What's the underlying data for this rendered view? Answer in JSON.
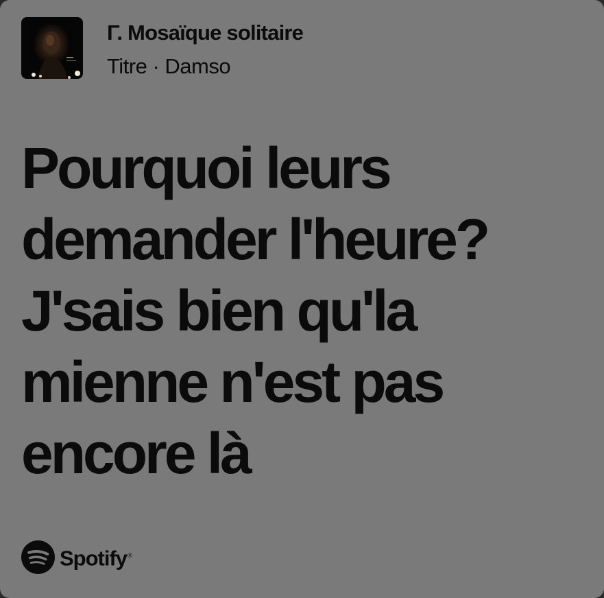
{
  "track": {
    "title": "Γ. Mosaïque solitaire",
    "subtitle": "Titre · Damso",
    "cover_icon": "album-cover-image"
  },
  "lyrics": {
    "lines": [
      "Pourquoi leurs",
      "demander l'heure?",
      "J'sais bien qu'la",
      "mienne n'est pas",
      "encore là"
    ]
  },
  "brand": {
    "name": "Spotify",
    "reg_mark": "®",
    "icon": "spotify-logo-icon"
  },
  "colors": {
    "background": "#7a7a7a",
    "text": "#0b0b0b"
  }
}
